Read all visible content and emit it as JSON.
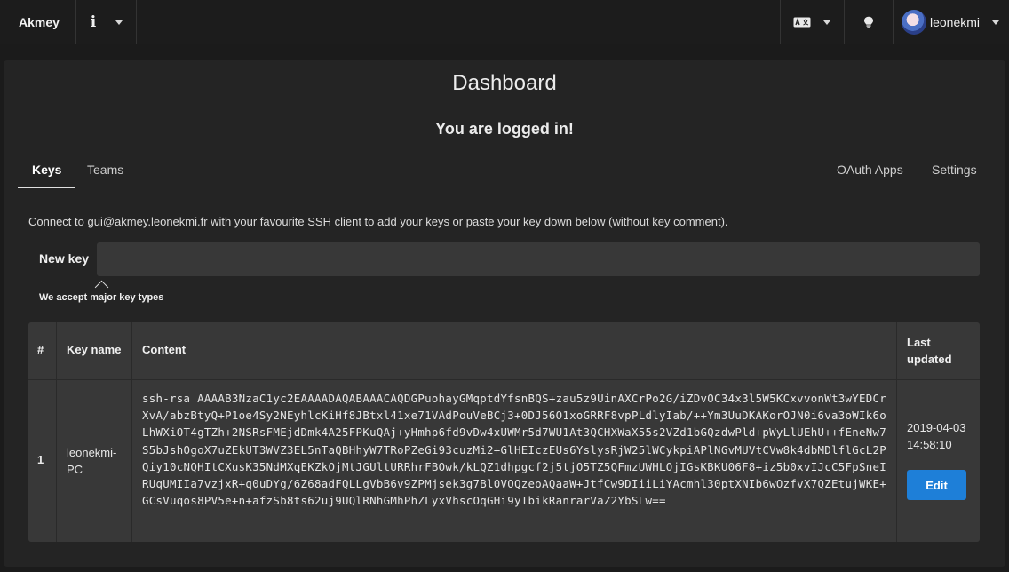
{
  "navbar": {
    "brand": "Akmey",
    "info_icon": "info-icon",
    "lang_icon": "translate-icon",
    "bulb_icon": "lightbulb-icon",
    "username": "leonekmi"
  },
  "main": {
    "title": "Dashboard",
    "status": "You are logged in!",
    "tabs": [
      {
        "label": "Keys",
        "active": true
      },
      {
        "label": "Teams",
        "active": false
      },
      {
        "label": "OAuth Apps",
        "active": false
      },
      {
        "label": "Settings",
        "active": false
      }
    ],
    "help_text": "Connect to gui@akmey.leonekmi.fr with your favourite SSH client to add your keys or paste your key down below (without key comment).",
    "new_key": {
      "label": "New key",
      "value": "",
      "hint": "We accept major key types"
    },
    "table": {
      "headers": [
        "#",
        "Key name",
        "Content",
        "Last updated"
      ],
      "rows": [
        {
          "index": "1",
          "name": "leonekmi-PC",
          "content": "ssh-rsa AAAAB3NzaC1yc2EAAAADAQABAAACAQDGPuohayGMqptdYfsnBQS+zau5z9UinAXCrPo2G/iZDvOC34x3l5W5KCxvvonWt3wYEDCrXvA/abzBtyQ+P1oe4Sy2NEyhlcKiHf8JBtxl41xe71VAdPouVeBCj3+0DJ56O1xoGRRF8vpPLdlyIab/++Ym3UuDKAKorOJN0i6va3oWIk6oLhWXiOT4gTZh+2NSRsFMEjdDmk4A25FPKuQAj+yHmhp6fd9vDw4xUWMr5d7WU1At3QCHXWaX55s2VZd1bGQzdwPld+pWyLlUEhU++fEneNw7S5bJshOgoX7uZEkUT3WVZ3EL5nTaQBHhyW7TRoPZeGi93cuzMi2+GlHEIczEUs6YslysRjW25lWCykpiAPlNGvMUVtCVw8k4dbMDlflGcL2PQiy10cNQHItCXusK35NdMXqEKZkOjMtJGUltURRhrFBOwk/kLQZ1dhpgcf2j5tjO5TZ5QFmzUWHLOjIGsKBKU06F8+iz5b0xvIJcC5FpSneIRUqUMIIa7vzjxR+q0uDYg/6Z68adFQLLgVbB6v9ZPMjsek3g7Bl0VOQzeoAQaaW+JtfCw9DIiiLiYAcmhl30ptXNIb6wOzfvX7QZEtujWKE+GCsVuqos8PV5e+n+afzSb8ts62uj9UQlRNhGMhPhZLyxVhscOqGHi9yTbikRanrarVaZ2YbSLw==",
          "last_updated": "2019-04-03 14:58:10",
          "action": "Edit"
        }
      ]
    }
  },
  "colors": {
    "background": "#1b1b1b",
    "card": "#242424",
    "input": "#383838",
    "accent": "#1e7fd8"
  }
}
